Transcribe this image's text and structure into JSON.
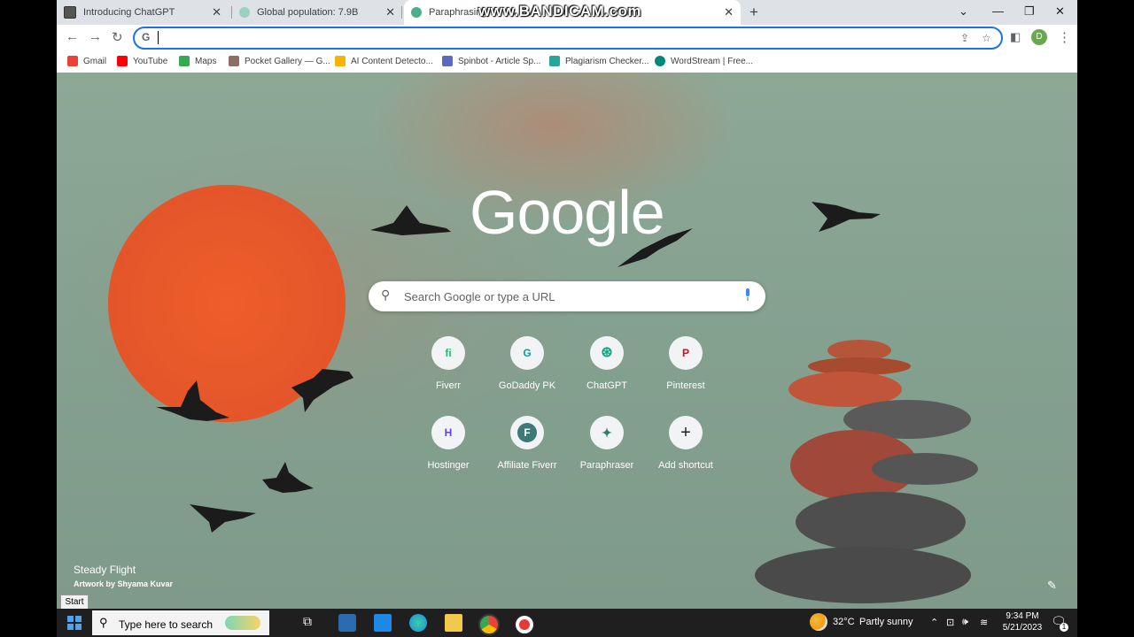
{
  "watermark": "www.BANDICAM.com",
  "tabs": [
    {
      "title": "Introducing ChatGPT",
      "icon": "chatgpt-icon"
    },
    {
      "title": "Global population: 7.9B",
      "icon": "globe-icon"
    },
    {
      "title": "Paraphrasing",
      "icon": "paraphraser-icon"
    }
  ],
  "toolbar": {
    "omnibox_value": "",
    "profile_initial": "D"
  },
  "bookmarks": [
    {
      "label": "Gmail",
      "color": "#ea4335"
    },
    {
      "label": "YouTube",
      "color": "#ff0000"
    },
    {
      "label": "Maps",
      "color": "#34a853"
    },
    {
      "label": "Pocket Gallery — G...",
      "color": "#8d6e63"
    },
    {
      "label": "AI Content Detecto...",
      "color": "#f4b400"
    },
    {
      "label": "Spinbot - Article Sp...",
      "color": "#5c6bc0"
    },
    {
      "label": "Plagiarism Checker...",
      "color": "#26a69a"
    },
    {
      "label": "WordStream | Free...",
      "color": "#00897b"
    }
  ],
  "ntp": {
    "logo": "Google",
    "search_placeholder": "Search Google or type a URL",
    "shortcuts": [
      {
        "label": "Fiverr",
        "glyph": "fi",
        "color": "#1dbf73"
      },
      {
        "label": "GoDaddy PK",
        "glyph": "G",
        "color": "#00a4a6"
      },
      {
        "label": "ChatGPT",
        "glyph": "⊛",
        "color": "#10a37f"
      },
      {
        "label": "Pinterest",
        "glyph": "P",
        "color": "#e60023"
      },
      {
        "label": "Hostinger",
        "glyph": "H",
        "color": "#673de6"
      },
      {
        "label": "Affiliate Fiverr",
        "glyph": "F",
        "color": "#3d7a77"
      },
      {
        "label": "Paraphraser",
        "glyph": "✦",
        "color": "#2e7d6b"
      },
      {
        "label": "Add shortcut",
        "glyph": "+",
        "color": "#202124"
      }
    ],
    "artwork_title": "Steady Flight",
    "artwork_credit": "Artwork by Shyama Kuvar"
  },
  "tooltip": "Start",
  "taskbar": {
    "search_placeholder": "Type here to search",
    "weather_temp": "32°C",
    "weather_desc": "Partly sunny",
    "time": "9:34 PM",
    "date": "5/21/2023",
    "notification_count": "1"
  }
}
